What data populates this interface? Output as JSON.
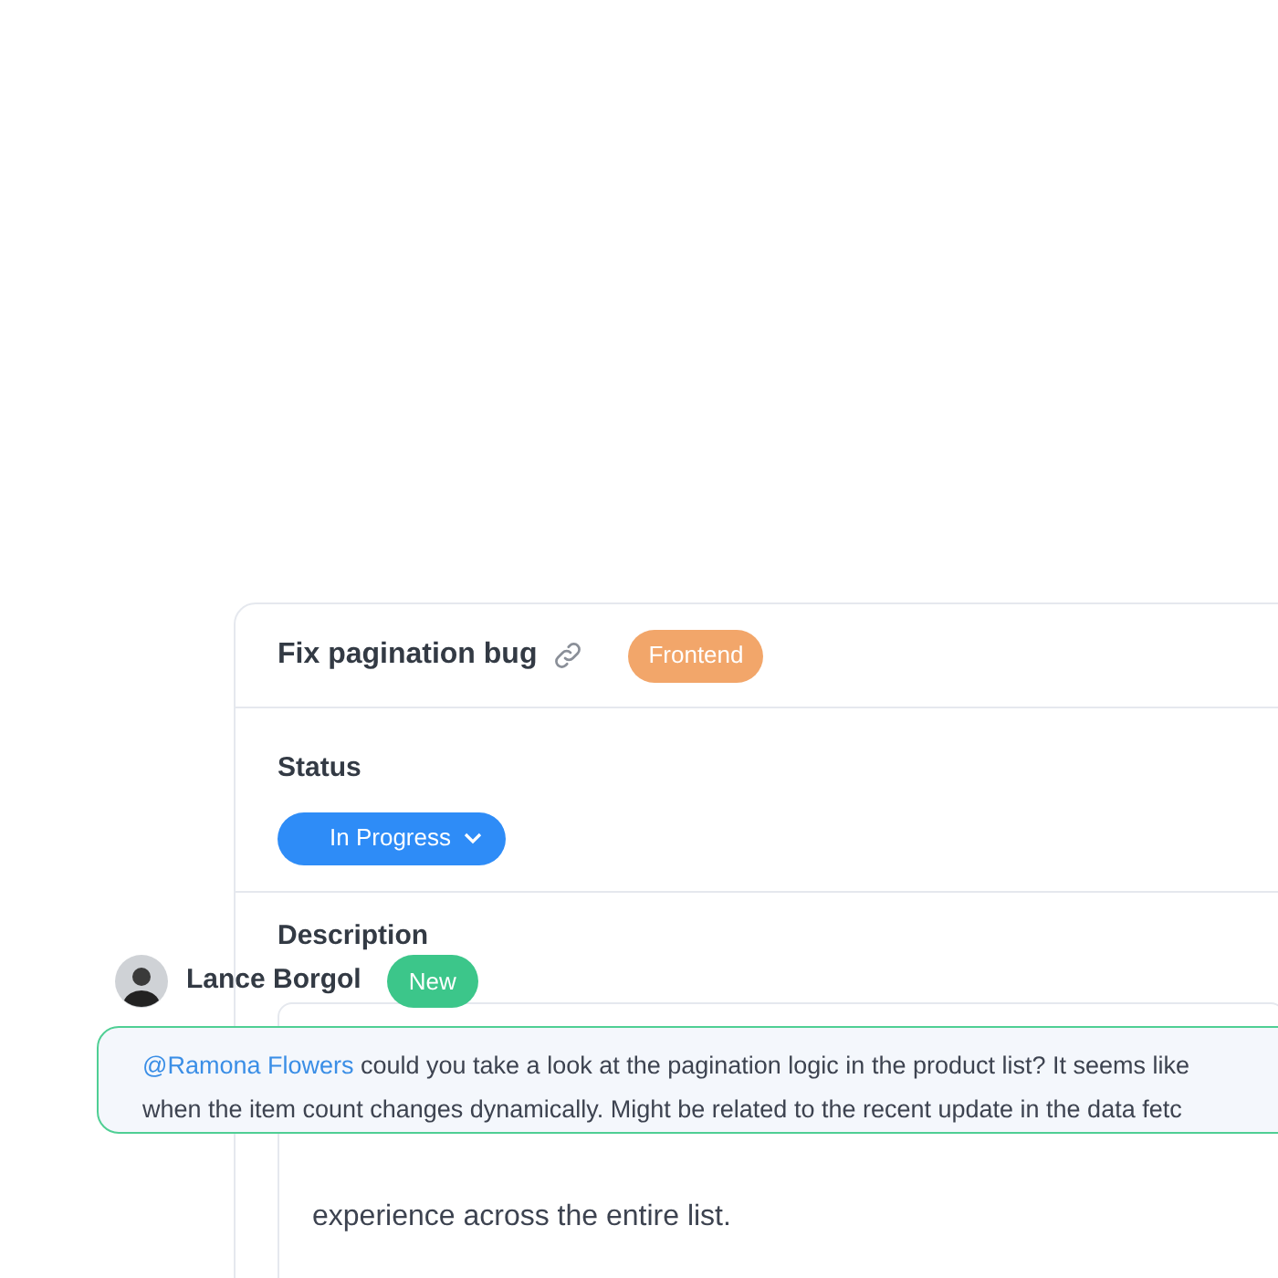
{
  "task": {
    "title": "Fix pagination bug",
    "tag": "Frontend"
  },
  "status": {
    "label": "Status",
    "value": "In Progress"
  },
  "description": {
    "label": "Description",
    "visible_text": "experience across the entire list."
  },
  "comment": {
    "author": "Lance Borgol",
    "badge": "New",
    "mention": "@Ramona Flowers",
    "lines": [
      " could you take a look at the pagination logic in the product list? It seems like",
      "when the item count changes dynamically. Might be related to the recent update in the data fetc"
    ]
  }
}
